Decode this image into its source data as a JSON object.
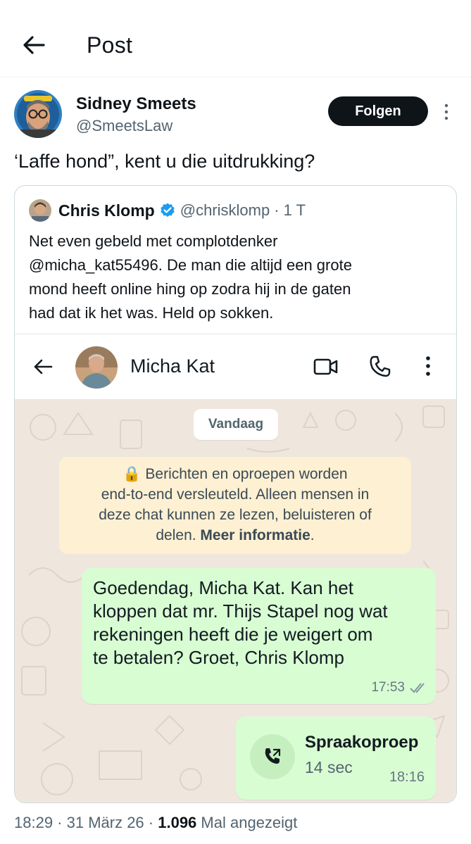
{
  "header": {
    "title": "Post"
  },
  "author": {
    "name": "Sidney Smeets",
    "handle": "@SmeetsLaw",
    "follow_label": "Folgen"
  },
  "post": {
    "text": "‘Laffe hond”, kent u die uitdrukking?"
  },
  "quote": {
    "name": "Chris Klomp",
    "handle": "@chrisklomp",
    "time": "· 1 T",
    "text_lines": [
      "Net even gebeld met complotdenker",
      "@micha_kat55496. De man die altijd een grote",
      "mond heeft online hing op zodra hij in de gaten",
      "had dat ik het was. Held op sokken."
    ]
  },
  "whatsapp": {
    "contact_name": "Micha Kat",
    "date_label": "Vandaag",
    "encryption_lines": [
      "🔒 Berichten en oproepen worden",
      "end-to-end versleuteld. Alleen mensen in",
      "deze chat kunnen ze lezen, beluisteren of"
    ],
    "encryption_last_prefix": "delen.",
    "encryption_link": "Meer informatie",
    "encryption_last_suffix": ".",
    "message": {
      "lines": [
        "Goedendag, Micha Kat. Kan het",
        "kloppen dat mr. Thijs Stapel nog wat",
        "rekeningen heeft die je weigert om",
        "te betalen? Groet, Chris Klomp"
      ],
      "time": "17:53"
    },
    "call": {
      "title": "Spraakoproep",
      "duration": "14 sec",
      "time": "18:16"
    }
  },
  "meta": {
    "timestamp": "18:29 · 31 März 26 ·",
    "views_count": "1.096",
    "views_label": "Mal angezeigt"
  },
  "colors": {
    "follow_bg": "#0f1419",
    "verified": "#1d9bf0",
    "chat_bg": "#efe7de",
    "outgoing_bubble": "#d9fdd3",
    "encryption_bg": "#fdf0d3"
  }
}
